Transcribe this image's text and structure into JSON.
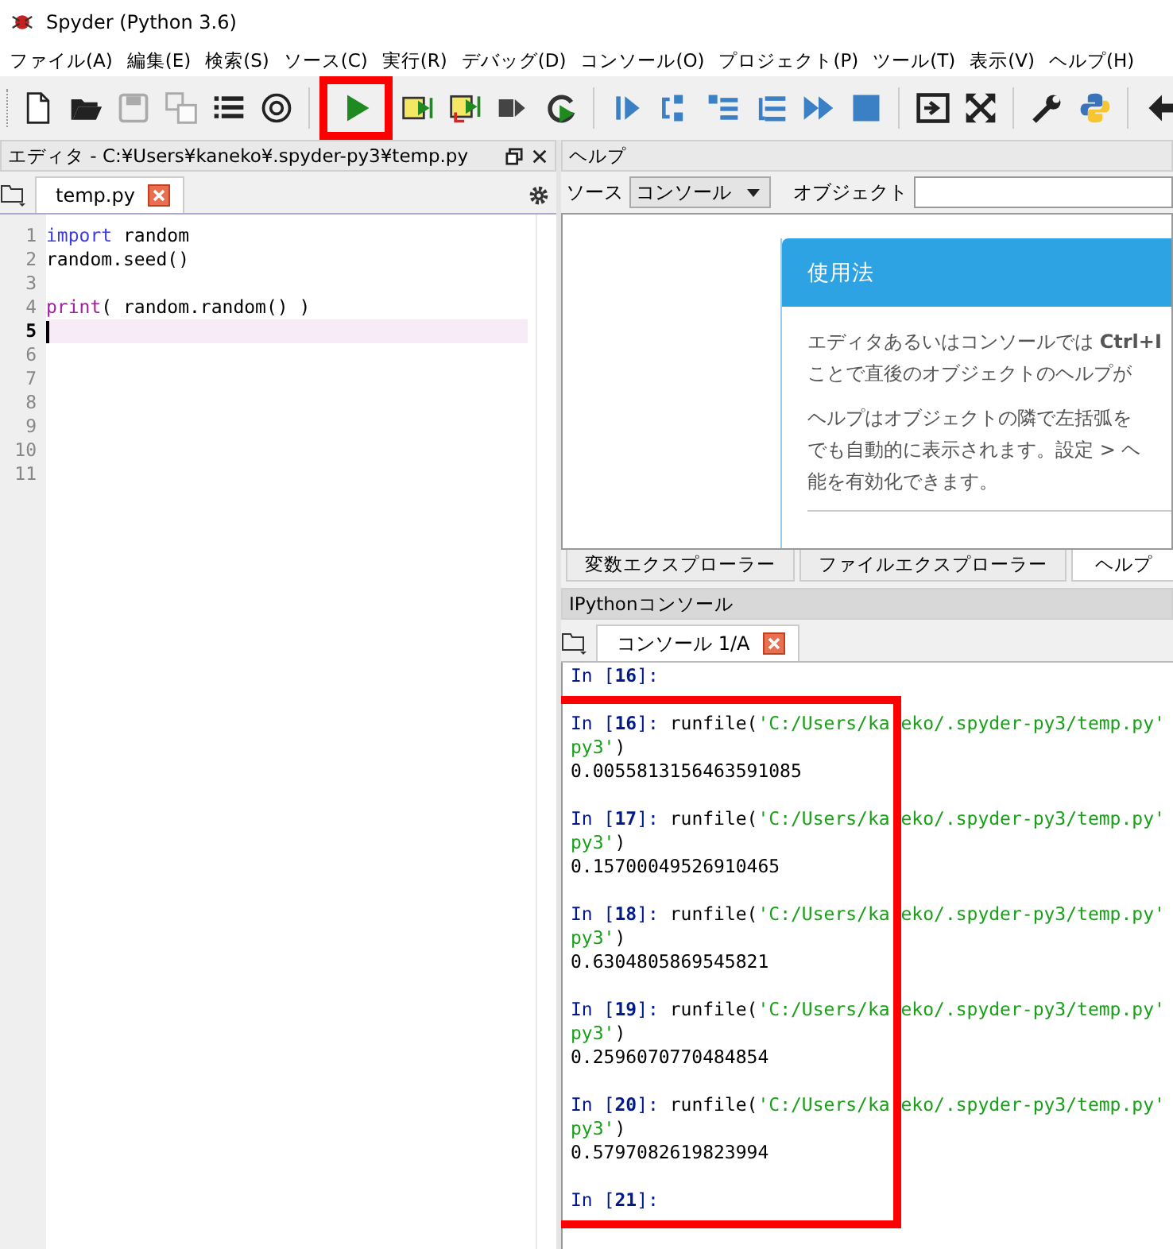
{
  "window": {
    "title": "Spyder (Python 3.6)"
  },
  "menu": [
    "ファイル(A)",
    "編集(E)",
    "検索(S)",
    "ソース(C)",
    "実行(R)",
    "デバッグ(D)",
    "コンソール(O)",
    "プロジェクト(P)",
    "ツール(T)",
    "表示(V)",
    "ヘルプ(H)"
  ],
  "toolbar": [
    {
      "disabled": false,
      "highlighted": false
    },
    {
      "disabled": false,
      "highlighted": false
    },
    {
      "disabled": true,
      "highlighted": false
    },
    {
      "disabled": true,
      "highlighted": false
    },
    {
      "disabled": false,
      "highlighted": false
    },
    {
      "disabled": false,
      "highlighted": false
    },
    {
      "disabled": false,
      "highlighted": true
    },
    {
      "disabled": false,
      "highlighted": false
    },
    {
      "disabled": false,
      "highlighted": false
    },
    {
      "disabled": false,
      "highlighted": false
    },
    {
      "disabled": false,
      "highlighted": false
    },
    {
      "disabled": false,
      "highlighted": false
    },
    {
      "disabled": false,
      "highlighted": false
    },
    {
      "disabled": false,
      "highlighted": false
    },
    {
      "disabled": false,
      "highlighted": false
    },
    {
      "disabled": false,
      "highlighted": false
    },
    {
      "disabled": false,
      "highlighted": false
    },
    {
      "disabled": false,
      "highlighted": false
    },
    {
      "disabled": false,
      "highlighted": false
    },
    {
      "disabled": false,
      "highlighted": false
    },
    {
      "disabled": false,
      "highlighted": false
    },
    {
      "disabled": false,
      "highlighted": false
    }
  ],
  "editor": {
    "title": "エディタ - C:¥Users¥kaneko¥.spyder-py3¥temp.py",
    "tabs": [
      {
        "label": "temp.py",
        "selected": true
      }
    ],
    "lines": [
      {
        "number": "1",
        "current": false,
        "tokens": [
          {
            "kind": "keyword",
            "text": "import"
          },
          {
            "kind": "plain",
            "text": " random"
          }
        ]
      },
      {
        "number": "2",
        "current": false,
        "tokens": [
          {
            "kind": "plain",
            "text": "random.seed()"
          }
        ]
      },
      {
        "number": "3",
        "current": false
      },
      {
        "number": "4",
        "current": false,
        "tokens": [
          {
            "kind": "builtin",
            "text": "print"
          },
          {
            "kind": "plain",
            "text": "( random.random() )"
          }
        ]
      },
      {
        "number": "5",
        "current": true
      },
      {
        "number": "6",
        "current": false
      },
      {
        "number": "7",
        "current": false
      },
      {
        "number": "8",
        "current": false
      },
      {
        "number": "9",
        "current": false
      },
      {
        "number": "10",
        "current": false
      },
      {
        "number": "11",
        "current": false
      }
    ]
  },
  "help": {
    "title": "ヘルプ",
    "source_label": "ソース",
    "source_value": "コンソール",
    "object_label": "オブジェクト",
    "card": {
      "heading": "使用法",
      "paragraphs": [
        [
          "エディタあるいはコンソールでは **Ctrl+I**",
          "ことで直後のオブジェクトのヘルプが"
        ],
        [
          "ヘルプはオブジェクトの隣で左括弧を",
          "でも自動的に表示されます。設定 > ヘ",
          "能を有効化できます。"
        ]
      ]
    },
    "tabs": [
      {
        "label": "変数エクスプローラー",
        "selected": false
      },
      {
        "label": "ファイルエクスプローラー",
        "selected": false
      },
      {
        "label": "ヘルプ",
        "selected": true
      }
    ]
  },
  "console": {
    "title": "IPythonコンソール",
    "tabs": [
      {
        "label": "コンソール 1/A",
        "selected": true
      }
    ],
    "highlighted": true,
    "lines": [
      {
        "kind": "prompt",
        "prompt": "In [**16**]:"
      },
      {
        "kind": "blank"
      },
      {
        "kind": "prompt",
        "prompt": "In [**16**]:",
        "call": "runfile(",
        "arg": "'C:/Users/ka",
        "arg_after": "eko/.spyder-py3/temp.py'"
      },
      {
        "kind": "continuation",
        "arg": "py3'",
        "close": ")"
      },
      {
        "kind": "output",
        "text": "0.0055813156463591085"
      },
      {
        "kind": "blank"
      },
      {
        "kind": "prompt",
        "prompt": "In [**17**]:",
        "call": "runfile(",
        "arg": "'C:/Users/ka",
        "arg_after": "eko/.spyder-py3/temp.py'"
      },
      {
        "kind": "continuation",
        "arg": "py3'",
        "close": ")"
      },
      {
        "kind": "output",
        "text": "0.15700049526910465"
      },
      {
        "kind": "blank"
      },
      {
        "kind": "prompt",
        "prompt": "In [**18**]:",
        "call": "runfile(",
        "arg": "'C:/Users/ka",
        "arg_after": "eko/.spyder-py3/temp.py'"
      },
      {
        "kind": "continuation",
        "arg": "py3'",
        "close": ")"
      },
      {
        "kind": "output",
        "text": "0.6304805869545821"
      },
      {
        "kind": "blank"
      },
      {
        "kind": "prompt",
        "prompt": "In [**19**]:",
        "call": "runfile(",
        "arg": "'C:/Users/ka",
        "arg_after": "eko/.spyder-py3/temp.py'"
      },
      {
        "kind": "continuation",
        "arg": "py3'",
        "close": ")"
      },
      {
        "kind": "output",
        "text": "0.2596070770484854"
      },
      {
        "kind": "blank"
      },
      {
        "kind": "prompt",
        "prompt": "In [**20**]:",
        "call": "runfile(",
        "arg": "'C:/Users/ka",
        "arg_after": "eko/.spyder-py3/temp.py'"
      },
      {
        "kind": "continuation",
        "arg": "py3'",
        "close": ")"
      },
      {
        "kind": "output",
        "text": "0.5797082619823994"
      },
      {
        "kind": "blank"
      },
      {
        "kind": "prompt",
        "prompt": "In [**21**]:"
      }
    ]
  }
}
